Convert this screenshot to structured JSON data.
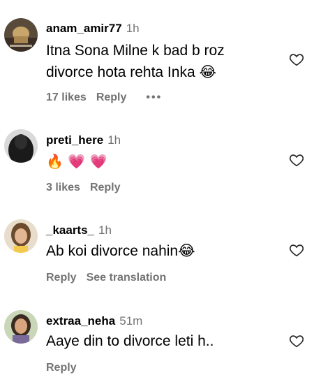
{
  "comments": [
    {
      "username": "anam_amir77",
      "time": "1h",
      "text_line1": "Itna Sona Milne k bad b roz",
      "text_line2": "divorce hota rehta Inka",
      "text_emoji": "😂",
      "likes": "17 likes",
      "reply": "Reply",
      "more": "•••"
    },
    {
      "username": "preti_here",
      "time": "1h",
      "emojis": "🔥 💗 💗",
      "likes": "3 likes",
      "reply": "Reply"
    },
    {
      "username": "_kaarts_",
      "time": "1h",
      "text": "Ab koi divorce nahin",
      "text_emoji": "😂",
      "reply": "Reply",
      "see_translation": "See translation"
    },
    {
      "username": "extraa_neha",
      "time": "51m",
      "text": "Aaye din to divorce leti h..",
      "reply": "Reply"
    }
  ]
}
